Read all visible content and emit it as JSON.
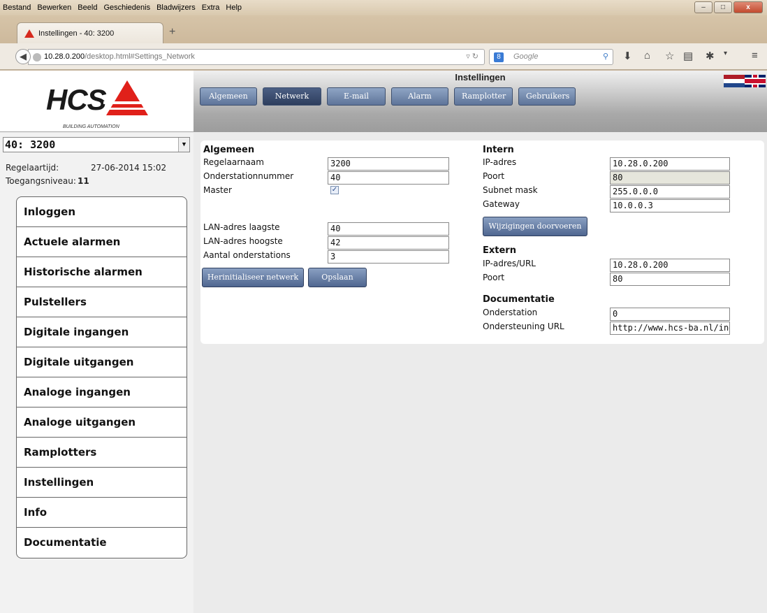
{
  "browser": {
    "menu": [
      "Bestand",
      "Bewerken",
      "Beeld",
      "Geschiedenis",
      "Bladwijzers",
      "Extra",
      "Help"
    ],
    "tab_title": "Instellingen - 40: 3200",
    "new_tab": "+",
    "url_host": "10.28.0.200",
    "url_path": "/desktop.html#Settings_Network",
    "search_placeholder": "Google",
    "window_buttons": {
      "minimize": "–",
      "maximize": "□",
      "close": "x"
    }
  },
  "header": {
    "title": "Instellingen",
    "logo_text": "HCS",
    "logo_sub": "BUILDING AUTOMATION",
    "tabs": [
      {
        "label": "Algemeen",
        "active": false
      },
      {
        "label": "Netwerk",
        "active": true
      },
      {
        "label": "E-mail",
        "active": false
      },
      {
        "label": "Alarm",
        "active": false
      },
      {
        "label": "Ramplotter",
        "active": false
      },
      {
        "label": "Gebruikers",
        "active": false
      }
    ]
  },
  "sidebar": {
    "station": "40: 3200",
    "regelaartijd_label": "Regelaartijd:",
    "regelaartijd_value": "27-06-2014 15:02",
    "toegang_label": "Toegangsniveau:",
    "toegang_value": "11",
    "items": [
      "Inloggen",
      "Actuele alarmen",
      "Historische alarmen",
      "Pulstellers",
      "Digitale ingangen",
      "Digitale uitgangen",
      "Analoge ingangen",
      "Analoge uitgangen",
      "Ramplotters",
      "Instellingen",
      "Info",
      "Documentatie"
    ]
  },
  "form": {
    "algemeen": {
      "heading": "Algemeen",
      "regelaarnaam_label": "Regelaarnaam",
      "regelaarnaam": "3200",
      "onderstation_label": "Onderstationnummer",
      "onderstation": "40",
      "master_label": "Master",
      "master_checked": true,
      "lan_laagste_label": "LAN-adres laagste",
      "lan_laagste": "40",
      "lan_hoogste_label": "LAN-adres hoogste",
      "lan_hoogste": "42",
      "aantal_label": "Aantal onderstations",
      "aantal": "3",
      "reinit_button": "Herinitialiseer netwerk",
      "save_button": "Opslaan"
    },
    "intern": {
      "heading": "Intern",
      "ip_label": "IP-adres",
      "ip": "10.28.0.200",
      "poort_label": "Poort",
      "poort": "80",
      "subnet_label": "Subnet mask",
      "subnet": "255.0.0.0",
      "gateway_label": "Gateway",
      "gateway": "10.0.0.3",
      "apply_button": "Wijzigingen doorvoeren"
    },
    "extern": {
      "heading": "Extern",
      "ip_label": "IP-adres/URL",
      "ip": "10.28.0.200",
      "poort_label": "Poort",
      "poort": "80"
    },
    "documentatie": {
      "heading": "Documentatie",
      "onderstation_label": "Onderstation",
      "onderstation": "0",
      "url_label": "Ondersteuning URL",
      "url": "http://www.hcs-ba.nl/index."
    }
  }
}
